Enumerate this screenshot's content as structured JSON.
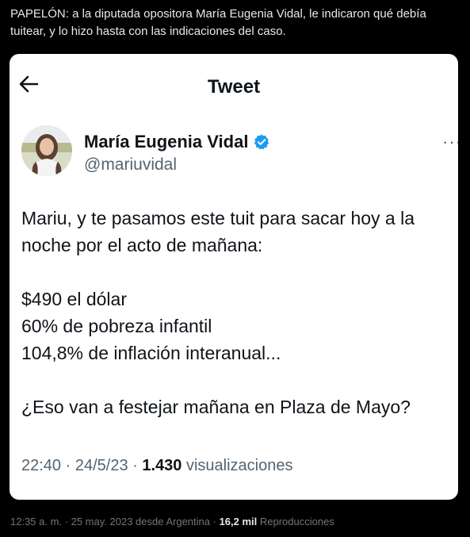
{
  "post": {
    "text": "PAPELÓN: a la diputada opositora María Eugenia Vidal, le indicaron qué debía tuitear, y lo hizo hasta con las indicaciones del caso."
  },
  "card": {
    "header_title": "Tweet",
    "author_name": "María Eugenia Vidal",
    "author_handle": "@mariuvidal",
    "more_label": "···",
    "body": {
      "line1": "Mariu, y te pasamos este tuit para sacar hoy a la noche por el acto de mañana:",
      "stat1": "$490 el dólar",
      "stat2": "60% de pobreza infantil",
      "stat3": "104,8% de inflación interanual...",
      "closing": "¿Eso van a festejar mañana en Plaza de Mayo?"
    },
    "meta": {
      "time": "22:40",
      "sep1": " · ",
      "date": "24/5/23",
      "sep2": " · ",
      "views_count": "1.430",
      "views_label": " visualizaciones"
    }
  },
  "footer": {
    "time": "12:35 a. m.",
    "sep1": " · ",
    "date_location": "25 may. 2023 desde Argentina",
    "sep2": " · ",
    "views_count": "16,2 mil",
    "views_label": " Reproducciones"
  },
  "colors": {
    "background": "#000000",
    "card": "#ffffff",
    "verified": "#1d9bf0",
    "secondary_text": "#536471"
  }
}
